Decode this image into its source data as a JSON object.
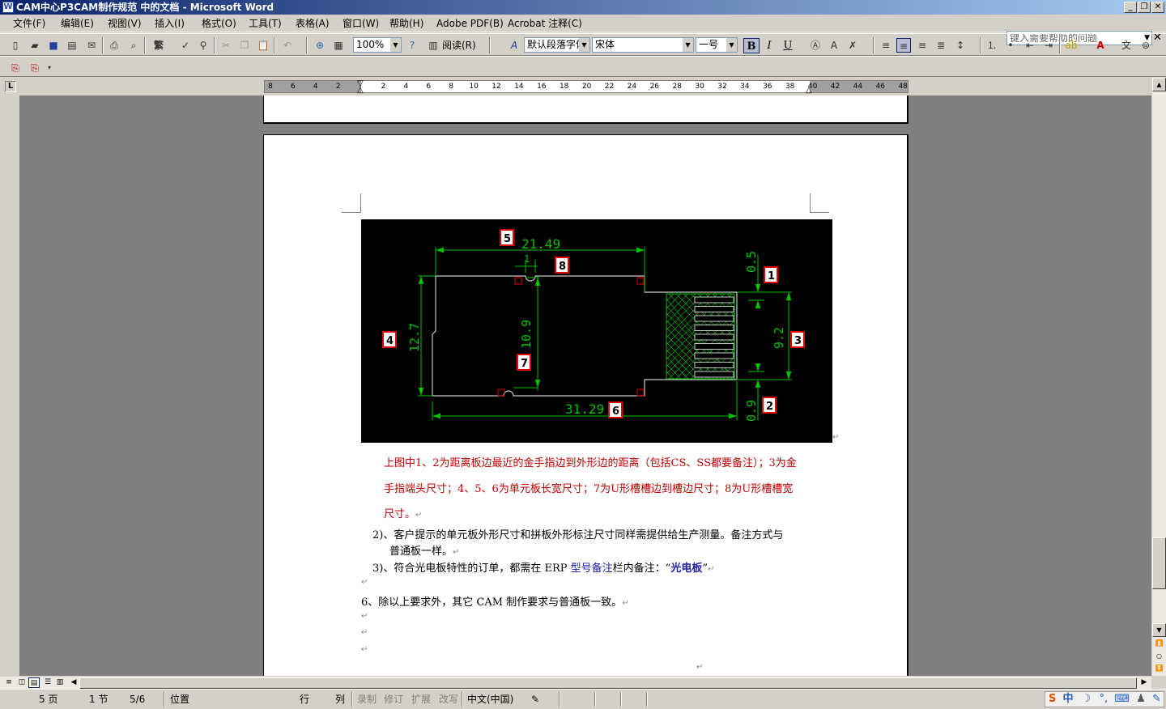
{
  "window": {
    "title": "CAM中心P3CAM制作规范 中的文档 - Microsoft Word",
    "help_placeholder": "键入需要帮助的问题"
  },
  "menu": [
    "文件(F)",
    "编辑(E)",
    "视图(V)",
    "插入(I)",
    "格式(O)",
    "工具(T)",
    "表格(A)",
    "窗口(W)",
    "帮助(H)",
    "Adobe PDF(B)",
    "Acrobat 注释(C)"
  ],
  "toolbar": {
    "traditional_label": "繁",
    "zoom": "100%",
    "read_label": "阅读(R)",
    "style": "默认段落字体",
    "font": "宋体",
    "size": "一号",
    "bold": "B",
    "italic": "I",
    "underline": "U"
  },
  "ruler": {
    "ticks": [
      "8",
      "6",
      "4",
      "2",
      "",
      "2",
      "4",
      "6",
      "8",
      "10",
      "12",
      "14",
      "16",
      "18",
      "20",
      "22",
      "24",
      "26",
      "28",
      "30",
      "32",
      "34",
      "36",
      "38",
      "40",
      "42",
      "44",
      "46",
      "48"
    ]
  },
  "figure": {
    "dims": {
      "d1": "21.49",
      "d2": "1",
      "d3": "0.5",
      "d4": "12.7",
      "d5": "10.9",
      "d6": "9.2",
      "d7": "31.29",
      "d8": "0.9"
    },
    "markers": [
      "1",
      "2",
      "3",
      "4",
      "5",
      "6",
      "7",
      "8"
    ],
    "colors": {
      "line": "#00c000",
      "outline": "#c8c8c8",
      "marker": "#e00000",
      "background": "#000000"
    }
  },
  "document": {
    "note_line1": "上图中1、2为距离板边最近的金手指边到外形边的距离（包括CS、SS都要备注）；3为金",
    "note_line2": "手指端头尺寸；4、5、6为单元板长宽尺寸；7为U形槽槽边到槽边尺寸；8为U形槽槽宽",
    "note_line3": "尺寸。",
    "item2_line1": "2)、客户提示的单元板外形尺寸和拼板外形标注尺寸同样需提供给生产测量。备注方式与",
    "item2_line2": "普通板一样。",
    "item3_prefix": "3)、符合光电板特性的订单，都需在 ERP ",
    "item3_field": "型号备注",
    "item3_mid": "栏内备注：“",
    "item3_value": "光电板",
    "item3_end": "”",
    "item6": "6、除以上要求外，其它 CAM 制作要求与普通板一致。",
    "para_mark": "↵"
  },
  "status": {
    "page": "5 页",
    "section": "1 节",
    "pages": "5/6",
    "position": "位置",
    "line": "行",
    "column": "列",
    "rec": "录制",
    "trk": "修订",
    "ext": "扩展",
    "ovr": "改写",
    "language": "中文(中国)",
    "ime_label": "中"
  }
}
